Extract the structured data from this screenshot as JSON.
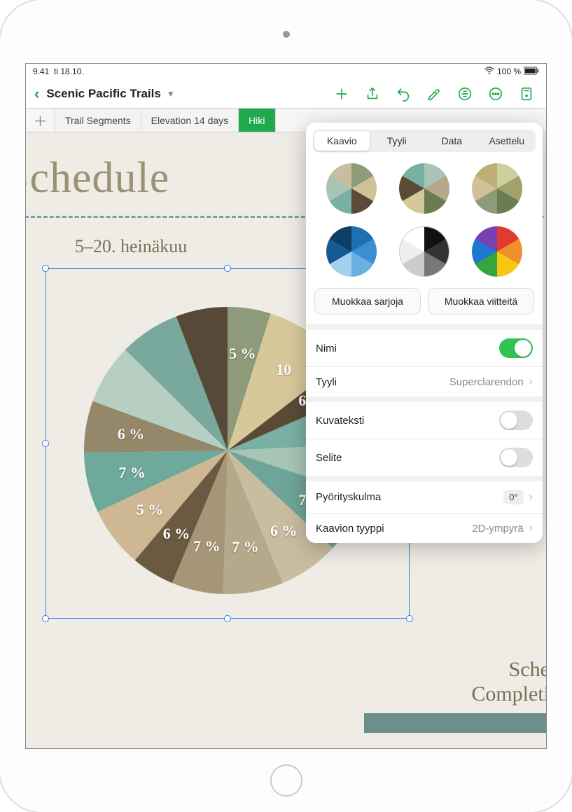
{
  "status": {
    "time": "9.41",
    "date": "ti 18.10.",
    "battery": "100 %",
    "wifi_icon": "wifi-icon",
    "battery_icon": "battery-icon"
  },
  "doc": {
    "title": "Scenic Pacific Trails"
  },
  "tabs": {
    "items": [
      {
        "label": "Trail Segments"
      },
      {
        "label": "Elevation 14 days"
      },
      {
        "label": "Hiki"
      }
    ]
  },
  "canvas": {
    "heading": "Schedule",
    "chart_title": "5–20. heinäkuu",
    "footer_line1": "Sched",
    "footer_line2": "Completin"
  },
  "chart_data": {
    "type": "pie",
    "title": "5–20. heinäkuu",
    "labels_visible": [
      "5 %",
      "10",
      "6 %",
      "7 %",
      "7 %",
      "7 %",
      "6 %",
      "7 %",
      "7 %",
      "6 %",
      "5 %",
      "7 %",
      "6 %"
    ],
    "slices": [
      {
        "value": 5,
        "color": "#8d9b7a"
      },
      {
        "value": 10,
        "color": "#d7c89a"
      },
      {
        "value": 4,
        "color": "#5b4a36"
      },
      {
        "value": 6,
        "color": "#7ab0a4"
      },
      {
        "value": 6,
        "color": "#a7c4b6"
      },
      {
        "value": 7,
        "color": "#6fa598"
      },
      {
        "value": 7,
        "color": "#c9bda0"
      },
      {
        "value": 7,
        "color": "#b6a98b"
      },
      {
        "value": 6,
        "color": "#a69678"
      },
      {
        "value": 5,
        "color": "#6b5942"
      },
      {
        "value": 7,
        "color": "#cdb893"
      },
      {
        "value": 7,
        "color": "#6fa99c"
      },
      {
        "value": 6,
        "color": "#95876a"
      },
      {
        "value": 7,
        "color": "#b7cfc3"
      },
      {
        "value": 7,
        "color": "#79a99c"
      },
      {
        "value": 6,
        "color": "#574938"
      }
    ]
  },
  "popover": {
    "tabs": {
      "t0": "Kaavio",
      "t1": "Tyyli",
      "t2": "Data",
      "t3": "Asettelu"
    },
    "style_palettes": [
      [
        "#8d9b7a",
        "#d0c196",
        "#5b4a36",
        "#7ab0a4",
        "#a7c4b6",
        "#c9bda0"
      ],
      [
        "#a7c4b6",
        "#b6a98b",
        "#6b7b52",
        "#d7c89a",
        "#5b4a36",
        "#7ab0a4"
      ],
      [
        "#cbd19c",
        "#a3a06a",
        "#6b7b52",
        "#8d9b7a",
        "#d0c196",
        "#bfae77"
      ],
      [
        "#1f6fb2",
        "#3a8fd0",
        "#6ab1e2",
        "#a3d1ef",
        "#175a92",
        "#0d3f66"
      ],
      [
        "#111",
        "#333",
        "#777",
        "#ccc",
        "#eee",
        "#fff"
      ],
      [
        "#e23b2e",
        "#f0902a",
        "#f6c712",
        "#35a63b",
        "#1f78d1",
        "#7a3fb5"
      ]
    ],
    "edit_series": "Muokkaa sarjoja",
    "edit_refs": "Muokkaa viitteitä",
    "rows": {
      "title_label": "Nimi",
      "title_on": true,
      "style_label": "Tyyli",
      "style_value": "Superclarendon",
      "caption_label": "Kuvateksti",
      "caption_on": false,
      "legend_label": "Selite",
      "legend_on": false,
      "rotation_label": "Pyörityskulma",
      "rotation_value": "0°",
      "type_label": "Kaavion tyyppi",
      "type_value": "2D-ympyrä"
    }
  }
}
